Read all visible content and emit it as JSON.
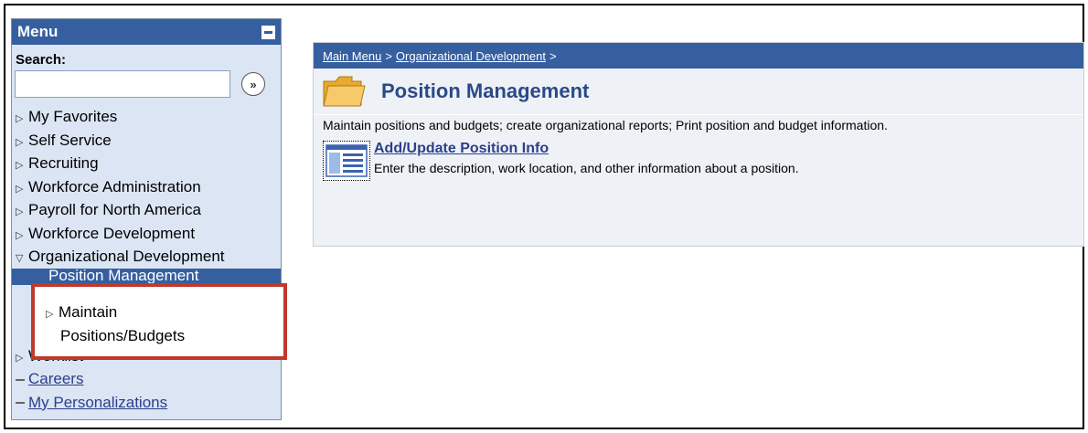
{
  "sidebar": {
    "title": "Menu",
    "search_label": "Search:",
    "search_value": "",
    "search_go_label": "»",
    "items": [
      {
        "label": "My Favorites",
        "marker": "▷"
      },
      {
        "label": "Self Service",
        "marker": "▷"
      },
      {
        "label": "Recruiting",
        "marker": "▷"
      },
      {
        "label": "Workforce Administration",
        "marker": "▷"
      },
      {
        "label": "Payroll for North America",
        "marker": "▷"
      },
      {
        "label": "Workforce Development",
        "marker": "▷"
      },
      {
        "label": "Organizational Development",
        "marker": "▽"
      }
    ],
    "selected_item": "Position Management",
    "submenu": {
      "marker": "▷",
      "line1": "Maintain",
      "line2": "Positions/Budgets"
    },
    "after_items": [
      {
        "label": "Worklist",
        "marker": "▷"
      }
    ],
    "links": [
      {
        "label": "Careers"
      },
      {
        "label": "My Personalizations"
      }
    ]
  },
  "breadcrumb": {
    "home": "Main Menu",
    "sep1": ">",
    "section": "Organizational Development",
    "sep2": ">"
  },
  "main": {
    "title": "Position Management",
    "description": "Maintain positions and budgets; create organizational reports; Print position and budget information.",
    "component": {
      "title": "Add/Update Position Info",
      "description": "Enter the description, work location, and other information about a position."
    }
  },
  "colors": {
    "header_blue": "#365f9f",
    "sidebar_bg": "#dbe5f4",
    "highlight_red": "#c0392b",
    "link_blue": "#2b3f8c"
  },
  "icons": [
    "collapse-icon",
    "search-go-icon",
    "folder-icon",
    "component-page-icon"
  ]
}
